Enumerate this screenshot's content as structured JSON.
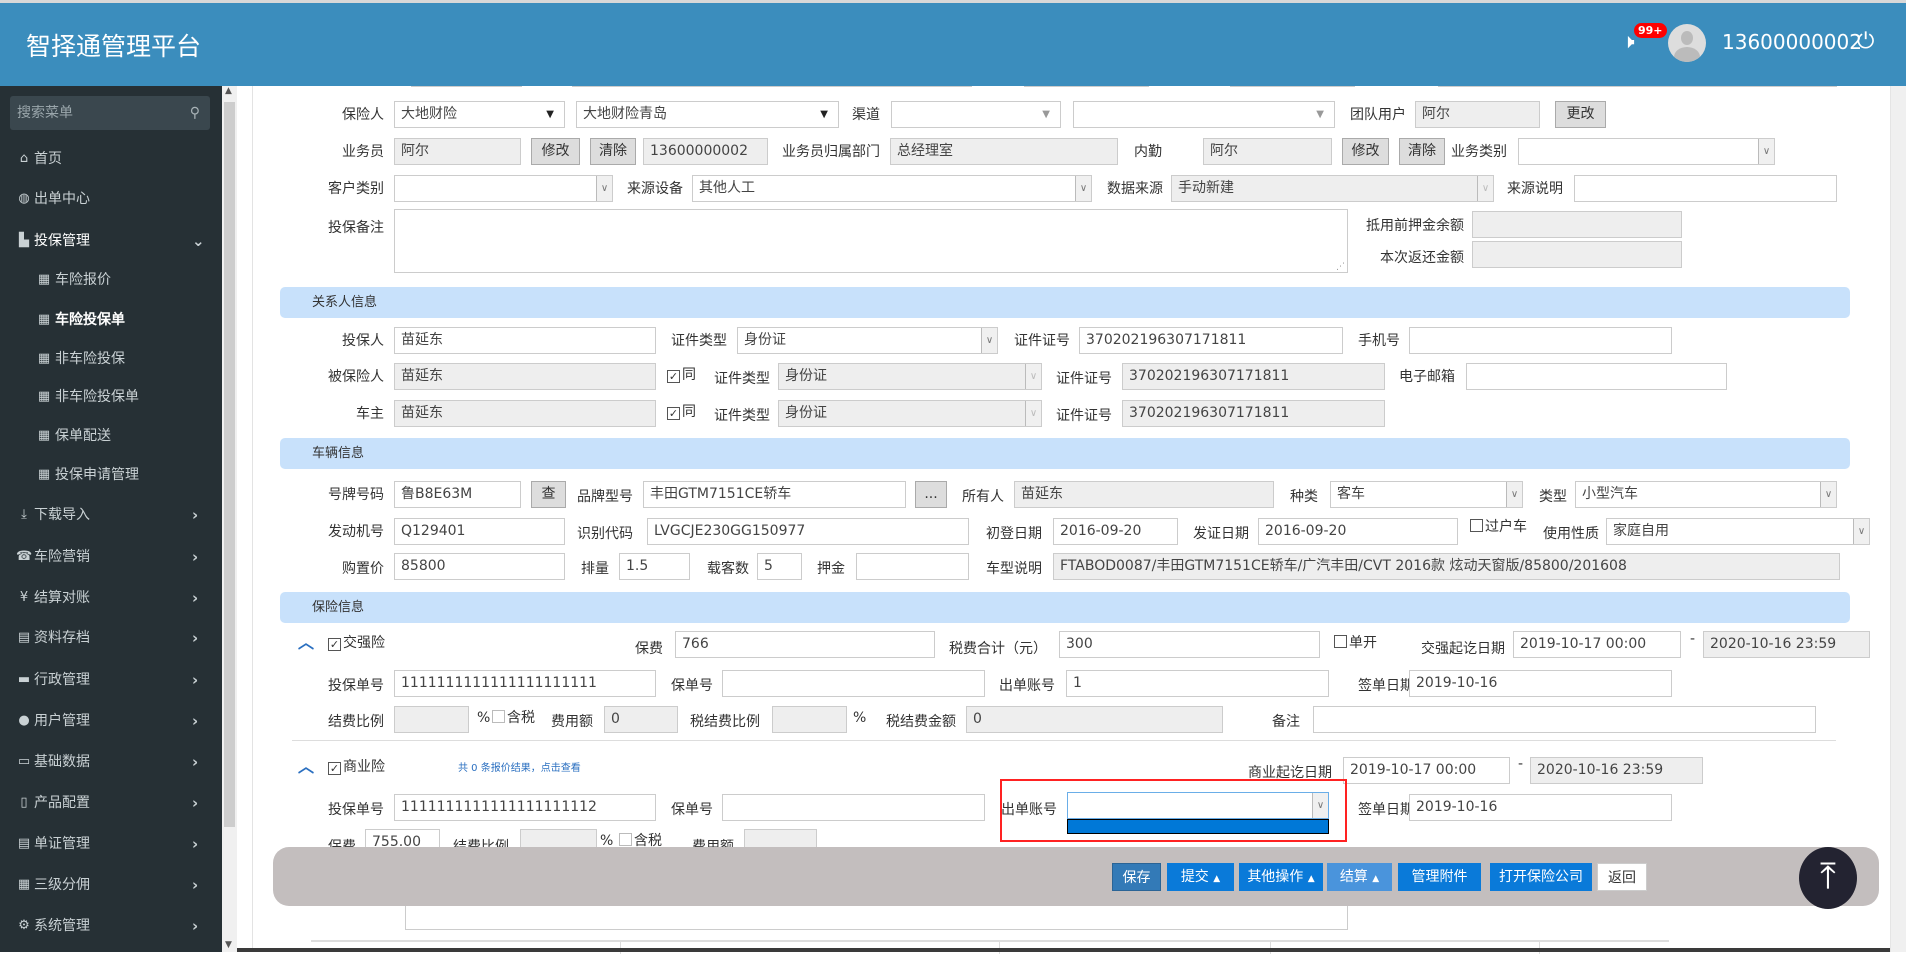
{
  "header": {
    "title": "智择通管理平台",
    "notification_count": "99+",
    "username": "13600000002",
    "icons": [
      "speaker-icon",
      "avatar",
      "power-icon"
    ]
  },
  "sidebar": {
    "search_placeholder": "搜索菜单",
    "items": [
      {
        "label": "首页",
        "icon": "home-icon"
      },
      {
        "label": "出单中心",
        "icon": "globe-icon"
      },
      {
        "label": "投保管理",
        "icon": "file-icon"
      },
      {
        "label": "车险报价",
        "icon": "grid-icon"
      },
      {
        "label": "车险投保单",
        "icon": "grid-icon"
      },
      {
        "label": "非车险投保",
        "icon": "grid-icon"
      },
      {
        "label": "非车险投保单",
        "icon": "grid-icon"
      },
      {
        "label": "保单配送",
        "icon": "grid-icon"
      },
      {
        "label": "投保申请管理",
        "icon": "grid-icon"
      },
      {
        "label": "下载导入",
        "icon": "download-icon"
      },
      {
        "label": "车险营销",
        "icon": "phone-icon"
      },
      {
        "label": "结算对账",
        "icon": "yen-icon"
      },
      {
        "label": "资料存档",
        "icon": "list-icon"
      },
      {
        "label": "行政管理",
        "icon": "folder-icon"
      },
      {
        "label": "用户管理",
        "icon": "user-icon"
      },
      {
        "label": "基础数据",
        "icon": "hdd-icon"
      },
      {
        "label": "产品配置",
        "icon": "book-icon"
      },
      {
        "label": "单证管理",
        "icon": "list-icon"
      },
      {
        "label": "三级分佣",
        "icon": "grid-icon"
      },
      {
        "label": "系统管理",
        "icon": "gear-icon"
      }
    ]
  },
  "top_form": {
    "insurer_label": "保险人",
    "insurer": "大地财险",
    "insurer_branch": "大地财险青岛",
    "channel_label": "渠道",
    "team_user_label": "团队用户",
    "team_user": "阿尔",
    "change_btn": "更改",
    "salesman_label": "业务员",
    "salesman": "阿尔",
    "modify_btn": "修改",
    "clear_btn": "清除",
    "salesman_phone": "13600000002",
    "dept_label": "业务员归属部门",
    "dept": "总经理室",
    "internal_label": "内勤",
    "internal": "阿尔",
    "business_type_label": "业务类别",
    "customer_type_label": "客户类别",
    "source_device_label": "来源设备",
    "source_device": "其他人工",
    "data_source_label": "数据来源",
    "data_source": "手动新建",
    "source_note_label": "来源说明",
    "remark_label": "投保备注",
    "deposit_balance_label": "抵用前押金余额",
    "refund_label": "本次返还金额"
  },
  "relations": {
    "title": "关系人信息",
    "applicant_label": "投保人",
    "applicant": "苗延东",
    "id_type_label": "证件类型",
    "id_type": "身份证",
    "id_no_label": "证件证号",
    "id_no": "370202196307171811",
    "phone_label": "手机号",
    "insured_label": "被保险人",
    "insured": "苗延东",
    "same_label": "同",
    "email_label": "电子邮箱",
    "owner_label": "车主",
    "owner": "苗延东"
  },
  "vehicle": {
    "title": "车辆信息",
    "plate_label": "号牌号码",
    "plate": "鲁B8E63M",
    "lookup_btn": "查",
    "brand_label": "品牌型号",
    "brand": "丰田GTM7151CE轿车",
    "more_btn": "...",
    "holder_label": "所有人",
    "holder": "苗延东",
    "kind_label": "种类",
    "kind": "客车",
    "type_label": "类型",
    "type": "小型汽车",
    "engine_label": "发动机号",
    "engine": "Q129401",
    "vin_label": "识别代码",
    "vin": "LVGCJE230GG150977",
    "reg_date_label": "初登日期",
    "reg_date": "2016-09-20",
    "cert_date_label": "发证日期",
    "cert_date": "2016-09-20",
    "transfer_label": "过户车",
    "usage_label": "使用性质",
    "usage": "家庭自用",
    "price_label": "购置价",
    "price": "85800",
    "displacement_label": "排量",
    "displacement": "1.5",
    "seats_label": "载客数",
    "seats": "5",
    "deposit_label": "押金",
    "model_desc_label": "车型说明",
    "model_desc": "FTABOD0087/丰田GTM7151CE轿车/广汽丰田/CVT 2016款 炫动天窗版/85800/201608"
  },
  "insurance": {
    "title": "保险信息",
    "compulsory": {
      "label": "交强险",
      "checked": true,
      "premium_label": "保费",
      "premium": "766",
      "tax_label": "税费合计（元）",
      "tax": "300",
      "single_label": "单开",
      "period_label": "交强起讫日期",
      "start": "2019-10-17 00:00",
      "dash": "-",
      "end": "2020-10-16 23:59",
      "app_no_label": "投保单号",
      "app_no": "1111111111111111111111",
      "policy_no_label": "保单号",
      "account_label": "出单账号",
      "account": "1",
      "sign_date_label": "签单日期",
      "sign_date": "2019-10-16",
      "fee_rate_label": "结费比例",
      "pct": "%",
      "tax_incl_label": "含税",
      "fee_amt_label": "费用额",
      "fee_amt": "0",
      "tax_fee_rate_label": "税结费比例",
      "tax_fee_amt_label": "税结费金额",
      "tax_fee_amt": "0",
      "note_label": "备注"
    },
    "commercial": {
      "label": "商业险",
      "checked": true,
      "quote_link": "共 0 条报价结果，点击查看",
      "period_label": "商业起讫日期",
      "start": "2019-10-17 00:00",
      "dash": "-",
      "end": "2020-10-16 23:59",
      "app_no_label": "投保单号",
      "app_no": "1111111111111111111112",
      "policy_no_label": "保单号",
      "account_label": "出单账号",
      "account": "",
      "sign_date_label": "签单日期",
      "sign_date": "2019-10-16",
      "premium_label": "保费",
      "premium": "755.00",
      "fee_rate_label": "结费比例",
      "pct": "%",
      "tax_incl_label": "含税",
      "fee_amt_label": "费用额"
    }
  },
  "actions": {
    "save": "保存",
    "submit": "提交",
    "other": "其他操作",
    "settle": "结算",
    "attachments": "管理附件",
    "open_company": "打开保险公司",
    "back": "返回"
  },
  "colors": {
    "header": "#3b8dbd",
    "sidebar": "#263035",
    "section": "#c8e1fb",
    "primary": "#0a7ad9",
    "highlight": "#ff2020"
  }
}
